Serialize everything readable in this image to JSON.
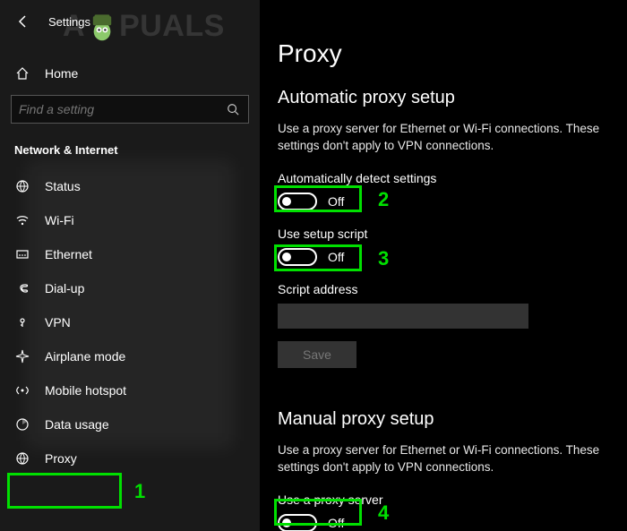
{
  "window": {
    "title": "Settings"
  },
  "sidebar": {
    "home_label": "Home",
    "search_placeholder": "Find a setting",
    "category": "Network & Internet",
    "items": [
      {
        "icon": "status",
        "label": "Status"
      },
      {
        "icon": "wifi",
        "label": "Wi-Fi"
      },
      {
        "icon": "ethernet",
        "label": "Ethernet"
      },
      {
        "icon": "dialup",
        "label": "Dial-up"
      },
      {
        "icon": "vpn",
        "label": "VPN"
      },
      {
        "icon": "airplane",
        "label": "Airplane mode"
      },
      {
        "icon": "hotspot",
        "label": "Mobile hotspot"
      },
      {
        "icon": "data",
        "label": "Data usage"
      },
      {
        "icon": "proxy",
        "label": "Proxy"
      }
    ],
    "active_index": 8
  },
  "content": {
    "page_title": "Proxy",
    "auto": {
      "title": "Automatic proxy setup",
      "desc": "Use a proxy server for Ethernet or Wi-Fi connections. These settings don't apply to VPN connections.",
      "detect_label": "Automatically detect settings",
      "detect_state": "Off",
      "script_label": "Use setup script",
      "script_state": "Off",
      "address_label": "Script address",
      "address_value": "",
      "save_label": "Save"
    },
    "manual": {
      "title": "Manual proxy setup",
      "desc": "Use a proxy server for Ethernet or Wi-Fi connections. These settings don't apply to VPN connections.",
      "use_label": "Use a proxy server",
      "use_state": "Off"
    }
  },
  "annotations": {
    "n1": "1",
    "n2": "2",
    "n3": "3",
    "n4": "4"
  },
  "watermark": {
    "before": "A",
    "after": "PUALS"
  }
}
